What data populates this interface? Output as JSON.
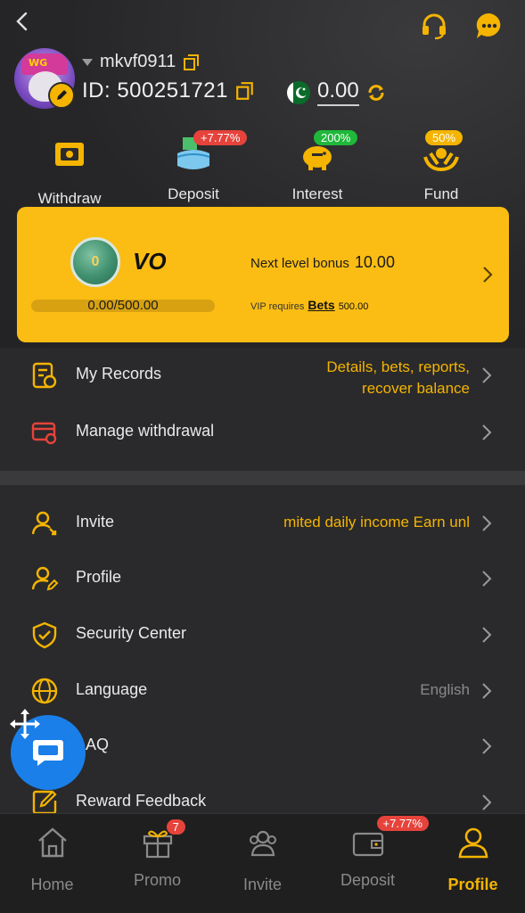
{
  "header": {
    "username": "mkvf0911",
    "id_label": "ID: 500251721",
    "balance": "0.00",
    "icons": {
      "back": "back-chevron-icon",
      "support": "headset-icon",
      "chat": "chat-bubble-icon"
    }
  },
  "quick_actions": [
    {
      "label": "Withdraw",
      "icon": "withdraw-icon",
      "badge": ""
    },
    {
      "label": "Deposit",
      "icon": "deposit-icon",
      "badge": "+7.77%"
    },
    {
      "label": "Interest",
      "icon": "piggy-bank-icon",
      "badge": "200%"
    },
    {
      "label": "Fund",
      "icon": "fund-hands-icon",
      "badge": "50%"
    }
  ],
  "vip": {
    "coin_label": "0",
    "level": "VO",
    "progress_text": "0.00/500.00",
    "progress_fraction": 0,
    "next_bonus_label": "Next level bonus",
    "next_bonus_amount": "10.00",
    "requires_label": "VIP requires",
    "requires_link": "Bets",
    "requires_amount": "500.00"
  },
  "menu_top": [
    {
      "label": "My Records",
      "value_line1": "Details, bets, reports,",
      "value_line2": "recover balance"
    },
    {
      "label": "Manage withdrawal",
      "value_line1": "",
      "value_line2": ""
    }
  ],
  "menu_bottom": [
    {
      "label": "Invite",
      "value": "mited daily income  Earn unl"
    },
    {
      "label": "Profile",
      "value": ""
    },
    {
      "label": "Security Center",
      "value": ""
    },
    {
      "label": "Language",
      "value": "English"
    },
    {
      "label": "AQ",
      "value": ""
    },
    {
      "label": "Reward Feedback",
      "value": ""
    }
  ],
  "tabs": [
    {
      "label": "Home",
      "badge": ""
    },
    {
      "label": "Promo",
      "badge": "7"
    },
    {
      "label": "Invite",
      "badge": ""
    },
    {
      "label": "Deposit",
      "badge": "+7.77%"
    },
    {
      "label": "Profile",
      "badge": ""
    }
  ],
  "colors": {
    "accent": "#f4b400",
    "vip_card": "#fbbd14",
    "badge_red": "#e5433b",
    "badge_green": "#1fb83a",
    "chat_fab": "#1a7fe8"
  }
}
